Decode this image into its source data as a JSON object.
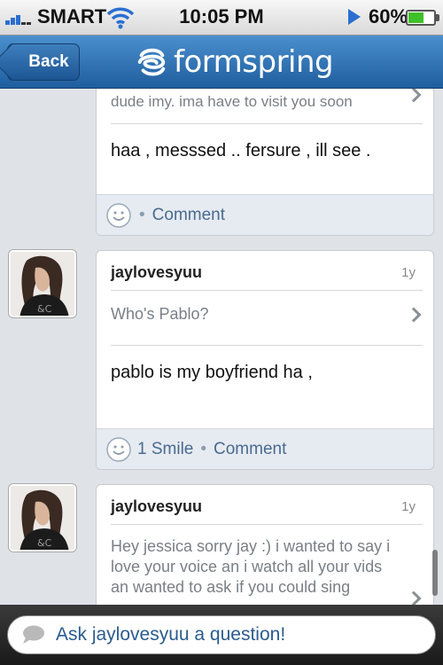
{
  "status_bar": {
    "carrier": "SMART",
    "time": "10:05 PM",
    "battery_percent": "60%",
    "battery_level": 0.6,
    "icons": [
      "signal-icon",
      "wifi-icon",
      "play-icon",
      "battery-icon"
    ]
  },
  "nav": {
    "back_label": "Back",
    "brand": "formspring"
  },
  "colors": {
    "nav_blue": "#2c6aab",
    "link_blue": "#4a6a90",
    "feed_bg": "#dfe3e8"
  },
  "posts": [
    {
      "question": "dude imy. ima have to visit you soon",
      "answer": "haa , messsed .. fersure , ill see .",
      "comment_label": "Comment"
    },
    {
      "username": "jaylovesyuu",
      "age": "1y",
      "question": "Who's Pablo?",
      "answer": "pablo is my boyfriend ha ,",
      "smile_label": "1 Smile",
      "comment_label": "Comment"
    },
    {
      "username": "jaylovesyuu",
      "age": "1y",
      "question": "Hey jessica sorry jay :) i wanted to say i love your voice an i watch all your vids an wanted to ask if you could sing"
    }
  ],
  "ask_bar": {
    "placeholder": "Ask jaylovesyuu a question!"
  }
}
